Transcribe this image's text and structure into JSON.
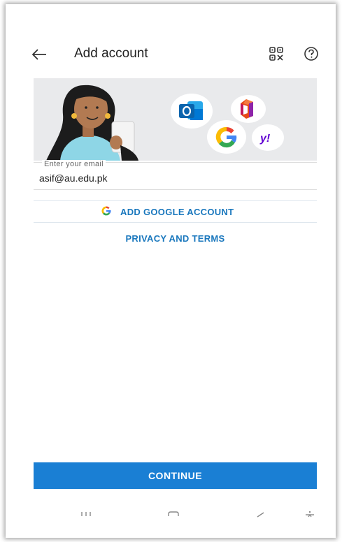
{
  "header": {
    "title": "Add account",
    "back_icon": "arrow-left-icon",
    "qr_icon": "qr-code-icon",
    "help_icon": "help-circle-icon"
  },
  "banner": {
    "icons": [
      "outlook-icon",
      "office-icon",
      "google-icon",
      "yahoo-icon"
    ]
  },
  "email_field": {
    "label": "Enter your email",
    "value": "asif@au.edu.pk"
  },
  "google_button": {
    "label": "ADD GOOGLE ACCOUNT",
    "icon": "google-g-icon"
  },
  "privacy_link": {
    "label": "PRIVACY AND TERMS"
  },
  "continue_button": {
    "label": "CONTINUE"
  },
  "navbar": {
    "items": [
      "recent-apps-icon",
      "home-icon",
      "back-nav-icon",
      "accessibility-icon"
    ]
  },
  "colors": {
    "accent": "#1a7fd4",
    "link": "#1977bd",
    "banner_bg": "#e9eaec"
  }
}
